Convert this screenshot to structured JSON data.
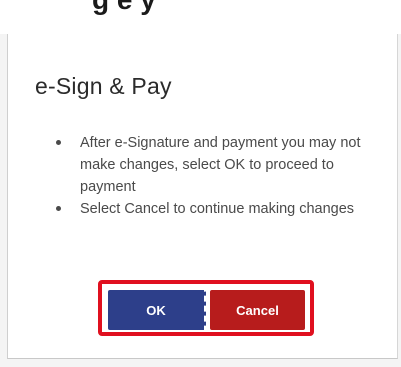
{
  "header_fragment": {
    "text": "g e   y"
  },
  "dialog": {
    "title": "e-Sign & Pay",
    "bullets": [
      "After e-Signature and payment you may not make changes, select OK to proceed to payment",
      "Select Cancel to continue making changes"
    ],
    "ok_label": "OK",
    "cancel_label": "Cancel"
  },
  "colors": {
    "ok_button": "#2d3f8a",
    "cancel_button": "#b71c1c",
    "highlight_frame": "#e0101f"
  }
}
